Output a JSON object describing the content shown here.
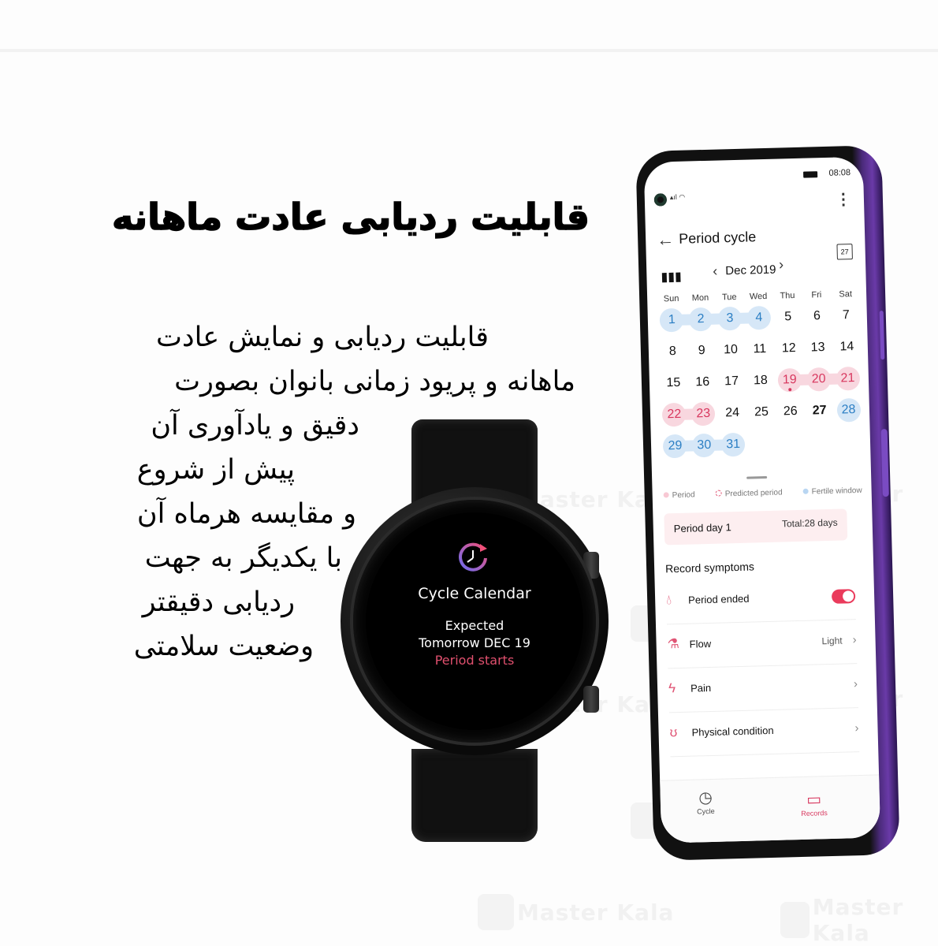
{
  "watermark": "Master Kala",
  "banner": {
    "title": "قابلیت ردیابی عادت ماهانه",
    "description_lines": [
      "قابلیت ردیابی و نمایش عادت",
      "ماهانه و پریود زمانی بانوان بصورت",
      "دقیق و یادآوری آن",
      "پیش از شروع",
      "و مقایسه هرماه آن",
      "با یکدیگر به جهت",
      "ردیابی دقیقتر",
      "وضعیت سلامتی"
    ]
  },
  "watch": {
    "app_title": "Cycle Calendar",
    "line1": "Expected",
    "line2": "Tomorrow DEC 19",
    "line3": "Period starts",
    "icon": "cycle-clock-icon",
    "accent": "#e0506e"
  },
  "phone": {
    "status": {
      "time": "08:08"
    },
    "appbar": {
      "title": "Period cycle",
      "back_icon": "arrow-left-icon",
      "more_icon": "more-vertical-icon"
    },
    "calendar": {
      "month_label": "Dec 2019",
      "today_icon_label": "27",
      "weekdays": [
        "Sun",
        "Mon",
        "Tue",
        "Wed",
        "Thu",
        "Fri",
        "Sat"
      ],
      "weeks": [
        [
          {
            "d": "1",
            "t": "fertile"
          },
          {
            "d": "2",
            "t": "fertile"
          },
          {
            "d": "3",
            "t": "fertile"
          },
          {
            "d": "4",
            "t": "fertile"
          },
          {
            "d": "5",
            "t": ""
          },
          {
            "d": "6",
            "t": ""
          },
          {
            "d": "7",
            "t": ""
          }
        ],
        [
          {
            "d": "8",
            "t": ""
          },
          {
            "d": "9",
            "t": ""
          },
          {
            "d": "10",
            "t": ""
          },
          {
            "d": "11",
            "t": ""
          },
          {
            "d": "12",
            "t": ""
          },
          {
            "d": "13",
            "t": ""
          },
          {
            "d": "14",
            "t": ""
          }
        ],
        [
          {
            "d": "15",
            "t": ""
          },
          {
            "d": "16",
            "t": ""
          },
          {
            "d": "17",
            "t": ""
          },
          {
            "d": "18",
            "t": ""
          },
          {
            "d": "19",
            "t": "period",
            "dot": true
          },
          {
            "d": "20",
            "t": "period"
          },
          {
            "d": "21",
            "t": "period"
          }
        ],
        [
          {
            "d": "22",
            "t": "period"
          },
          {
            "d": "23",
            "t": "period"
          },
          {
            "d": "24",
            "t": ""
          },
          {
            "d": "25",
            "t": ""
          },
          {
            "d": "26",
            "t": ""
          },
          {
            "d": "27",
            "t": "today"
          },
          {
            "d": "28",
            "t": "fertile"
          }
        ],
        [
          {
            "d": "29",
            "t": "fertile"
          },
          {
            "d": "30",
            "t": "fertile"
          },
          {
            "d": "31",
            "t": "fertile"
          }
        ]
      ]
    },
    "legend": [
      {
        "label": "Period",
        "color": "#f8c9d4"
      },
      {
        "label": "Predicted period",
        "color": "#e05575"
      },
      {
        "label": "Fertile window",
        "color": "#b9d6f2"
      }
    ],
    "summary": {
      "left": "Period day 1",
      "right": "Total:28 days"
    },
    "record_title": "Record symptoms",
    "records": [
      {
        "label": "Period ended",
        "icon": "drop-icon",
        "toggle": true
      },
      {
        "label": "Flow",
        "icon": "flask-icon",
        "value": "Light"
      },
      {
        "label": "Pain",
        "icon": "lightning-icon",
        "value": ""
      },
      {
        "label": "Physical condition",
        "icon": "body-icon",
        "value": ""
      }
    ],
    "tabs": [
      {
        "label": "Cycle",
        "icon": "clock-icon",
        "active": false
      },
      {
        "label": "Records",
        "icon": "calendar-icon",
        "active": true
      }
    ],
    "accent": "#d8385f"
  }
}
